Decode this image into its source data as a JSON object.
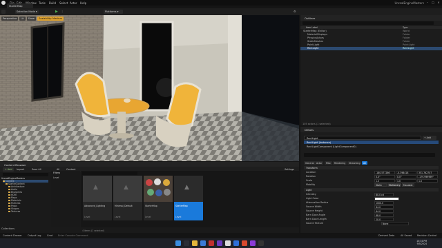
{
  "menu": [
    "File",
    "Edit",
    "Window",
    "Tools",
    "Build",
    "Select",
    "Actor",
    "Help"
  ],
  "project_title": "UnrealEngineMasters",
  "map_tab": "StarterMap",
  "toolbar": {
    "mode": "Selection Mode",
    "platforms": "Platforms"
  },
  "viewport": {
    "chips": [
      "Perspective",
      "Lit",
      "Show"
    ],
    "warning": "Scalability: Medium"
  },
  "outliner": {
    "title": "Outliner",
    "col_label": "Item Label",
    "col_type": "Type",
    "rows": [
      {
        "label": "StarterMap (Editor)",
        "type": "World"
      },
      {
        "label": "MaterialDisplays",
        "type": "Folder"
      },
      {
        "label": "PhysicsActors",
        "type": "Folder"
      },
      {
        "label": "StaticMeshes",
        "type": "Folder"
      },
      {
        "label": "PointLight",
        "type": "PointLight"
      },
      {
        "label": "RectLight",
        "type": "RectLight"
      }
    ],
    "count": "105 actors (1 selected)"
  },
  "details": {
    "title": "Details",
    "name": "RectLight",
    "component": "RectLight (Instance)",
    "subcomponent": "RectLightComponent (LightComponent0)",
    "add_label": "+ Add",
    "tabs": [
      "General",
      "Actor",
      "Misc",
      "Rendering",
      "Streaming",
      "All"
    ],
    "sections": [
      "Transform",
      "Light"
    ],
    "transform": [
      {
        "label": "Location",
        "values": [
          "-180.577266",
          "-0.398418",
          "351.762707"
        ]
      },
      {
        "label": "Rotation",
        "values": [
          "0.0°",
          "0.0°",
          "-179.999999°"
        ]
      },
      {
        "label": "Scale",
        "values": [
          "1.0",
          "1.0",
          "1.0"
        ]
      }
    ],
    "mobility": {
      "label": "Mobility",
      "options": [
        "Static",
        "Stationary",
        "Movable"
      ]
    },
    "light_props": [
      {
        "label": "Intensity",
        "value": "80.0 cd"
      },
      {
        "label": "Light Color",
        "value": ""
      },
      {
        "label": "Attenuation Radius",
        "value": "1000.0"
      },
      {
        "label": "Source Width",
        "value": "64.0"
      },
      {
        "label": "Source Height",
        "value": "64.0"
      },
      {
        "label": "Barn Door Angle",
        "value": "88.0"
      },
      {
        "label": "Barn Door Length",
        "value": "20.0"
      },
      {
        "label": "Source Texture",
        "value": "None"
      }
    ]
  },
  "content_browser": {
    "title": "Content Browser",
    "add": "+ Add",
    "import": "Import",
    "save_all": "Save All",
    "path": [
      "All",
      "Content"
    ],
    "settings": "Settings",
    "filters": "Filters",
    "filter_item": "Level",
    "search_placeholder": "Search Content",
    "project_root": "UnrealEngineMasters",
    "tree": [
      "Content",
      "StarterContent",
      "Architecture",
      "Audio",
      "Blueprints",
      "HDRI",
      "Maps",
      "Materials",
      "Particles",
      "Props",
      "Shapes",
      "Textures",
      "Collections"
    ],
    "assets": [
      {
        "label": "Advanced_Lighting",
        "type": "Level"
      },
      {
        "label": "Minimal_Default",
        "type": "Level"
      },
      {
        "label": "StarterMap",
        "type": "Level"
      },
      {
        "label": "StarterMap",
        "type": "Level"
      }
    ],
    "count": "4 items (1 selected)"
  },
  "bottom_bar": {
    "content_drawer": "Content Drawer",
    "output_log": "Output Log",
    "cmd": "Cmd",
    "console": "Enter Console Command",
    "derived": "Derived Data",
    "all_saved": "All Saved",
    "revision": "Revision Control"
  },
  "clock": {
    "time": "10:34 PM",
    "date": "9/5/2024"
  },
  "colors": {
    "accent": "#1a7adb",
    "folder": "#d4a84a",
    "warning": "#e0a32e"
  }
}
